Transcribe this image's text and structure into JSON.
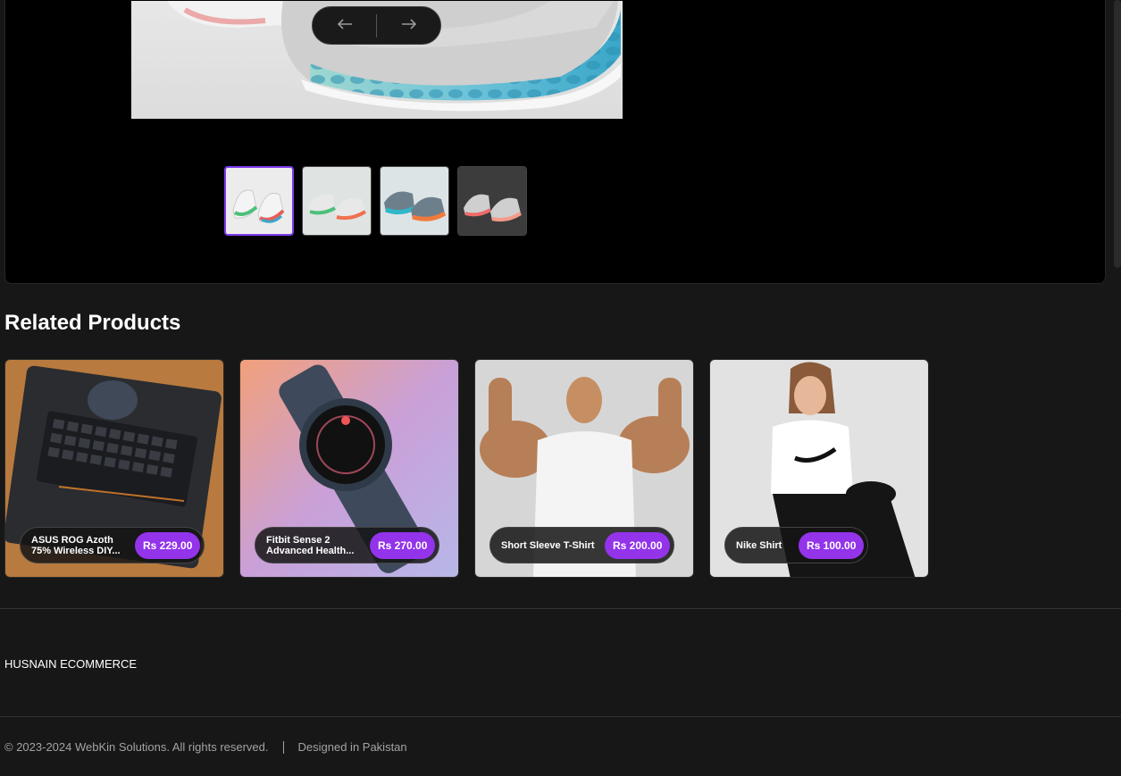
{
  "gallery": {
    "prev_icon": "arrow-left-icon",
    "next_icon": "arrow-right-icon",
    "thumbnails": [
      "thumbnail-1",
      "thumbnail-2",
      "thumbnail-3",
      "thumbnail-4"
    ],
    "active_thumbnail": 0
  },
  "related": {
    "title": "Related Products",
    "products": [
      {
        "name": "ASUS ROG Azoth 75% Wireless DIY...",
        "price": "Rs 229.00"
      },
      {
        "name": "Fitbit Sense 2 Advanced Health...",
        "price": "Rs 270.00"
      },
      {
        "name": "Short Sleeve T-Shirt",
        "price": "Rs 200.00"
      },
      {
        "name": "Nike Shirt",
        "price": "Rs 100.00"
      }
    ]
  },
  "footer": {
    "brand": "HUSNAIN ECOMMERCE",
    "copyright": "© 2023-2024 WebKin Solutions. All rights reserved.",
    "designed": "Designed in Pakistan"
  },
  "colors": {
    "accent": "#9333ea",
    "active_border": "#7c3aed",
    "background": "#171717"
  }
}
